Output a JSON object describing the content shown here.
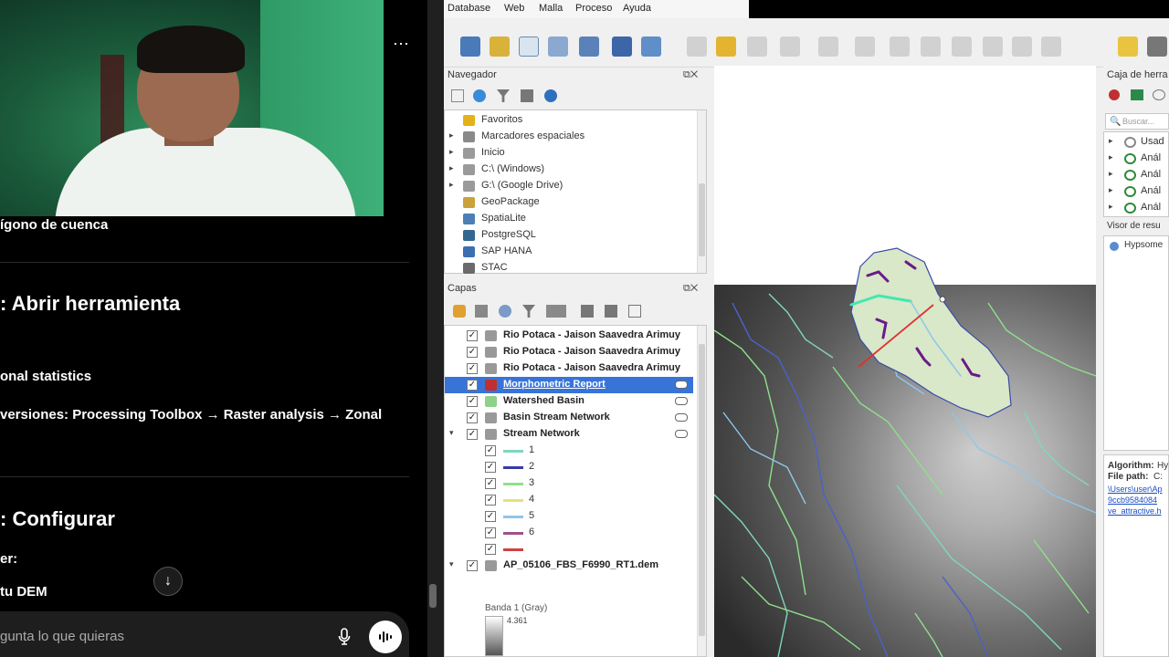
{
  "chat": {
    "lines": [
      "ígono de cuenca",
      ": Abrir herramienta",
      "onal statistics",
      "versiones: Processing Toolbox → Raster analysis → Zonal",
      ": Configurar",
      "er:",
      "tu DEM"
    ],
    "more_icon": "⋯",
    "scroll_icon": "↓",
    "prompt_placeholder": "gunta lo que quieras"
  },
  "qgis": {
    "menu": [
      "Database",
      "Web",
      "Malla",
      "Proceso",
      "Ayuda"
    ],
    "navigator": {
      "title": "Navegador",
      "items": [
        {
          "label": "Favoritos",
          "icon": "star-icon",
          "color": "#e3b21b"
        },
        {
          "label": "Marcadores espaciales",
          "icon": "bookmark-icon",
          "color": "#8a8a8a"
        },
        {
          "label": "Inicio",
          "icon": "folder-icon",
          "color": "#9a9a9a"
        },
        {
          "label": "C:\\ (Windows)",
          "icon": "folder-icon",
          "color": "#9a9a9a"
        },
        {
          "label": "G:\\ (Google Drive)",
          "icon": "folder-icon",
          "color": "#9a9a9a"
        },
        {
          "label": "GeoPackage",
          "icon": "geopackage-icon",
          "color": "#c9a23a"
        },
        {
          "label": "SpatiaLite",
          "icon": "spatialite-icon",
          "color": "#4c7fb6"
        },
        {
          "label": "PostgreSQL",
          "icon": "postgresql-icon",
          "color": "#336791"
        },
        {
          "label": "SAP HANA",
          "icon": "sap-hana-icon",
          "color": "#3c6fb0"
        },
        {
          "label": "STAC",
          "icon": "stac-icon",
          "color": "#6a6a6a"
        }
      ]
    },
    "layers": {
      "title": "Capas",
      "items": [
        {
          "label": "Rio Potaca - Jaison Saavedra Arimuy",
          "indent": 0,
          "selected": false
        },
        {
          "label": "Rio Potaca - Jaison Saavedra Arimuy",
          "indent": 0,
          "selected": false
        },
        {
          "label": "Rio Potaca - Jaison Saavedra Arimuy",
          "indent": 0,
          "selected": false
        },
        {
          "label": "Morphometric Report",
          "indent": 0,
          "selected": true
        },
        {
          "label": "Watershed Basin",
          "indent": 0,
          "selected": false
        },
        {
          "label": "Basin Stream Network",
          "indent": 0,
          "selected": false
        },
        {
          "label": "Stream Network",
          "indent": 0,
          "selected": false
        },
        {
          "label": "1",
          "indent": 1,
          "color": "#7fd6c0"
        },
        {
          "label": "2",
          "indent": 1,
          "color": "#3a3aa8"
        },
        {
          "label": "3",
          "indent": 1,
          "color": "#8fe08a"
        },
        {
          "label": "4",
          "indent": 1,
          "color": "#e8e07a"
        },
        {
          "label": "5",
          "indent": 1,
          "color": "#8ec7ea"
        },
        {
          "label": "6",
          "indent": 1,
          "color": "#a0508a"
        },
        {
          "label": "",
          "indent": 1,
          "color": "#d04040"
        },
        {
          "label": "AP_05106_FBS_F6990_RT1.dem",
          "indent": 0,
          "selected": false
        }
      ],
      "band_label": "Banda 1 (Gray)",
      "band_value": "4.361"
    },
    "toolbox": {
      "title": "Caja de herra",
      "search_placeholder": "Buscar...",
      "items": [
        "Usad",
        "Anál",
        "Anál",
        "Anál",
        "Anál"
      ],
      "results_title": "Visor de resu",
      "result_item": "Hypsome",
      "algorithm_label": "Algorithm:",
      "algorithm_value": "Hy",
      "filepath_label": "File path:",
      "filepath_value": "C:",
      "links": [
        "\\Users\\user\\Ap",
        "9ccb9584084",
        "ve_attractive.h"
      ]
    }
  }
}
